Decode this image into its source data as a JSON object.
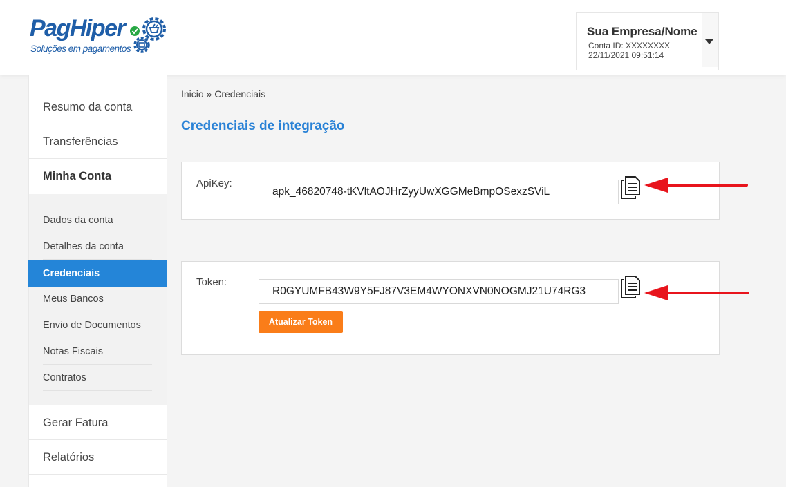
{
  "brand": {
    "name": "PagHiper",
    "tagline": "Soluções em pagamentos",
    "primary_color": "#1f5ea8",
    "check_color": "#27a844"
  },
  "account": {
    "name": "Sua Empresa/Nome",
    "id_text": "Conta ID: XXXXXXXX",
    "datetime": "22/11/2021 09:51:14",
    "menu_icon": "caret-down-icon"
  },
  "sidebar": {
    "main_items": [
      {
        "label": "Resumo da conta"
      },
      {
        "label": "Transferências"
      },
      {
        "label": "Minha Conta"
      }
    ],
    "sub_items": [
      {
        "label": "Dados da conta"
      },
      {
        "label": "Detalhes da conta"
      },
      {
        "label": "Credenciais",
        "active": true
      },
      {
        "label": "Meus Bancos"
      },
      {
        "label": "Envio de Documentos"
      },
      {
        "label": "Notas Fiscais"
      },
      {
        "label": "Contratos"
      }
    ],
    "bottom_items": [
      {
        "label": "Gerar Fatura"
      },
      {
        "label": "Relatórios"
      }
    ],
    "active_color": "#2485d8"
  },
  "main": {
    "breadcrumb": "Inicio » Credenciais",
    "title": "Credenciais de integração",
    "apikey": {
      "label": "ApiKey:",
      "value": "apk_46820748-tKVltAOJHrZyyUwXGGMeBmpOSexzSViL",
      "copy_icon": "copy-document-icon"
    },
    "token": {
      "label": "Token:",
      "value": "R0GYUMFB43W9Y5FJ87V3EM4WYONXVN0NOGMJ21U74RG3",
      "copy_icon": "copy-document-icon",
      "update_button": "Atualizar Token"
    },
    "title_color": "#2a82d6",
    "button_color": "#fa7d19",
    "annotation_arrow_color": "#e8141c"
  }
}
